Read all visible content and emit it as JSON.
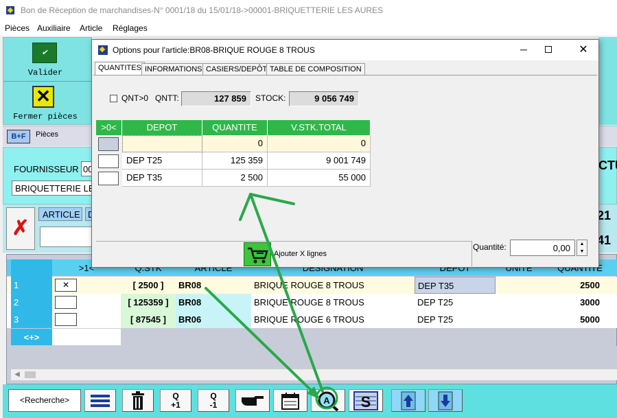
{
  "window": {
    "title": "Bon de Réception de marchandises-N° 0001/18 du 15/01/18->00001-BRIQUETTERIE LES AURES",
    "menu": [
      "Pièces",
      "Auxiliaire",
      "Article",
      "Réglages"
    ]
  },
  "left_panel": {
    "validate_label": "Valider",
    "close_label": "Fermer pièces"
  },
  "pieces_bar": {
    "badge": "B+F",
    "label": "Pièces"
  },
  "supplier": {
    "label": "FOURNISSEUR",
    "code": "00",
    "name": "BRIQUETTERIE LE",
    "right_partial": "CTU"
  },
  "article_row": {
    "article_label": "ARTICLE",
    "d_label": "D",
    "num1": "21",
    "num2": "41"
  },
  "main_grid": {
    "headers": [
      ">1<",
      "Q.STK",
      "ARTICLE",
      "DESIGNATION",
      "DEPOT",
      "UNITE",
      "QUANTITE"
    ],
    "rows": [
      {
        "num": "1",
        "qstk": "[ 2500 ]",
        "article": "BR08",
        "designation": "BRIQUE ROUGE 8 TROUS",
        "depot": "DEP T35",
        "unite": "",
        "quantite": "2500"
      },
      {
        "num": "2",
        "qstk": "[ 125359 ]",
        "article": "BR08",
        "designation": "BRIQUE ROUGE 8 TROUS",
        "depot": "DEP T25",
        "unite": "",
        "quantite": "3000"
      },
      {
        "num": "3",
        "qstk": "[ 87545 ]",
        "article": "BR06",
        "designation": "BRIQUE ROUGE 6 TROUS",
        "depot": "DEP T25",
        "unite": "",
        "quantite": "5000"
      }
    ],
    "add_row": "<+>"
  },
  "toolbar": {
    "search": "<Recherche>",
    "q_plus": "Q\n+1",
    "q_minus": "Q\n-1"
  },
  "dialog": {
    "title": "Options pour l'article:BR08-BRIQUE ROUGE 8 TROUS",
    "tabs": [
      "QUANTITES",
      "INFORMATIONS",
      "CASIERS/DEPÔT",
      "TABLE DE COMPOSITION"
    ],
    "qnt_filter": "QNT>0",
    "qntt_label": "QNTT:",
    "qntt_value": "127 859",
    "stock_label": "STOCK:",
    "stock_value": "9 056 749",
    "headers": [
      ">0<",
      "DEPOT",
      "QUANTITE",
      "V.STK.TOTAL"
    ],
    "rows": [
      {
        "depot": "",
        "quantite": "0",
        "total": "0"
      },
      {
        "depot": "DEP T25",
        "quantite": "125 359",
        "total": "9 001 749"
      },
      {
        "depot": "DEP T35",
        "quantite": "2 500",
        "total": "55 000"
      }
    ],
    "add_lines": "Ajouter X lignes",
    "quantity_label": "Quantité:",
    "quantity_value": "0,00"
  },
  "colors": {
    "accent_cyan": "#5ee0e0",
    "grid_green": "#2eb84a",
    "annotation_green": "#2aa84a"
  }
}
